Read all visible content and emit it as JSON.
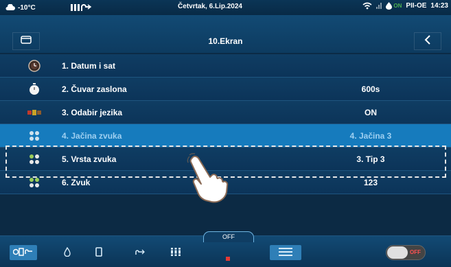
{
  "statusbar": {
    "temperature": "-10°C",
    "date": "Četvrtak, 6.Lip.2024",
    "status_tag": "ON",
    "mode": "PII-OE",
    "time": "14:23"
  },
  "header": {
    "title": "10.Ekran"
  },
  "menu": {
    "items": [
      {
        "label": "1.  Datum i sat",
        "value": "",
        "icon": "clock-icon"
      },
      {
        "label": "2.  Čuvar zaslona",
        "value": "600s",
        "icon": "stopwatch-icon"
      },
      {
        "label": "3.  Odabir jezika",
        "value": "ON",
        "icon": "language-icon"
      },
      {
        "label": "4.  Jačina zvuka",
        "value": "4. Jačina 3",
        "icon": "sound-level-icon"
      },
      {
        "label": "5.  Vrsta zvuka",
        "value": "3. Tip 3",
        "icon": "sound-type-icon"
      },
      {
        "label": "6.  Zvuk",
        "value": "123",
        "icon": "sound-icon"
      }
    ],
    "selected_index": 3
  },
  "bottombar": {
    "off_label": "OFF",
    "toggle_label": "OFF"
  },
  "colors": {
    "background": "#0c3459",
    "selected_row": "#167bbd",
    "accent_red": "#e53935"
  }
}
